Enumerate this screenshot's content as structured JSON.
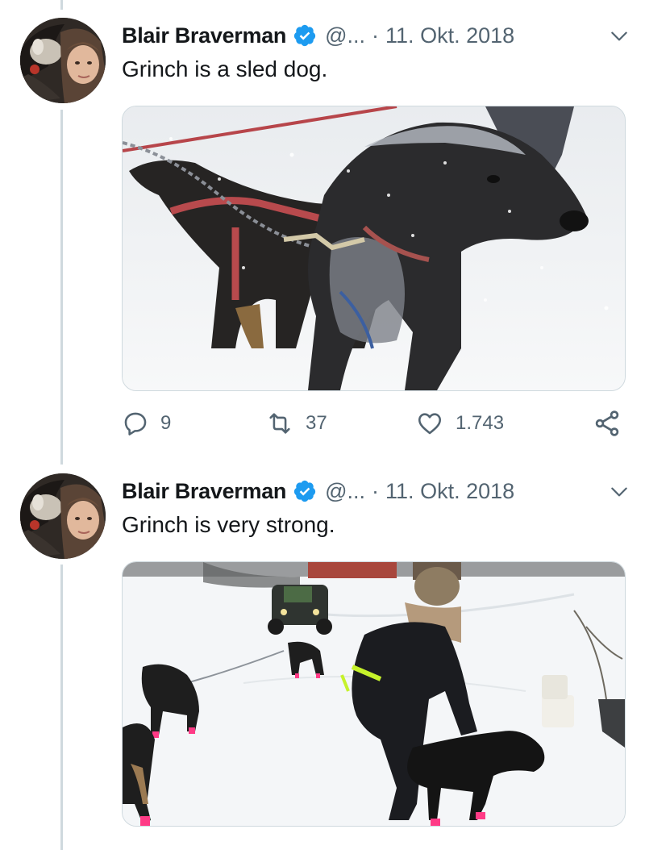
{
  "tweets": [
    {
      "author_name": "Blair Braverman",
      "handle": "@...",
      "separator": "·",
      "date": "11. Okt. 2018",
      "text": "Grinch is a sled dog.",
      "reply_count": "9",
      "retweet_count": "37",
      "like_count": "1.743"
    },
    {
      "author_name": "Blair Braverman",
      "handle": "@...",
      "separator": "·",
      "date": "11. Okt. 2018",
      "text": "Grinch is very strong."
    }
  ],
  "icons": {
    "verified": "verified-badge-icon",
    "more": "chevron-down-icon",
    "reply": "reply-icon",
    "retweet": "retweet-icon",
    "like": "heart-icon",
    "share": "share-icon"
  },
  "colors": {
    "verified_blue": "#1d9bf0",
    "secondary_text": "#536471",
    "thread_line": "#cfd9de"
  }
}
